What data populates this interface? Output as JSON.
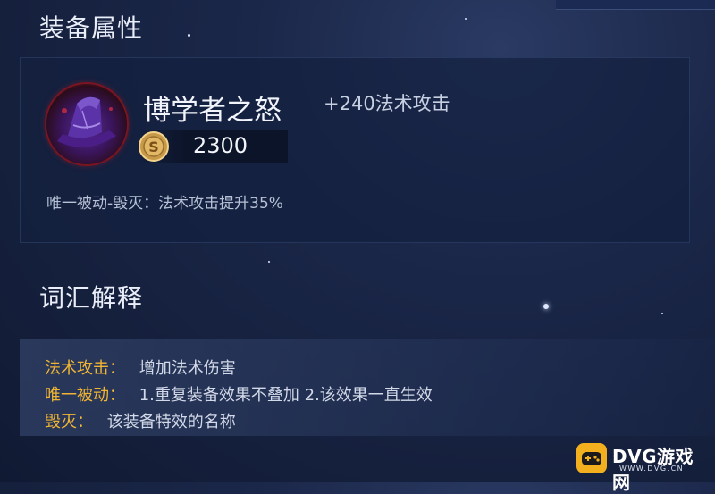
{
  "equipment_section": {
    "title": "装备属性",
    "item": {
      "icon": "arcane-hat-icon",
      "name": "博学者之怒",
      "stat": "+240法术攻击",
      "price_icon": "gold-coin-icon",
      "price": "2300",
      "passive": "唯一被动-毁灭：法术攻击提升35%"
    }
  },
  "glossary_section": {
    "title": "词汇解释",
    "entries": [
      {
        "term": "法术攻击：",
        "definition": "增加法术伤害"
      },
      {
        "term": "唯一被动：",
        "definition": "1.重复装备效果不叠加 2.该效果一直生效"
      },
      {
        "term": "毁灭：",
        "definition": "该装备特效的名称"
      }
    ]
  },
  "watermark": {
    "brand": "DVG游戏网",
    "url": "WWW.DVG.CN",
    "icon": "gamepad-icon"
  },
  "colors": {
    "term_accent": "#f0b534",
    "background": "#15203d",
    "icon_glow": "#8a1422"
  }
}
